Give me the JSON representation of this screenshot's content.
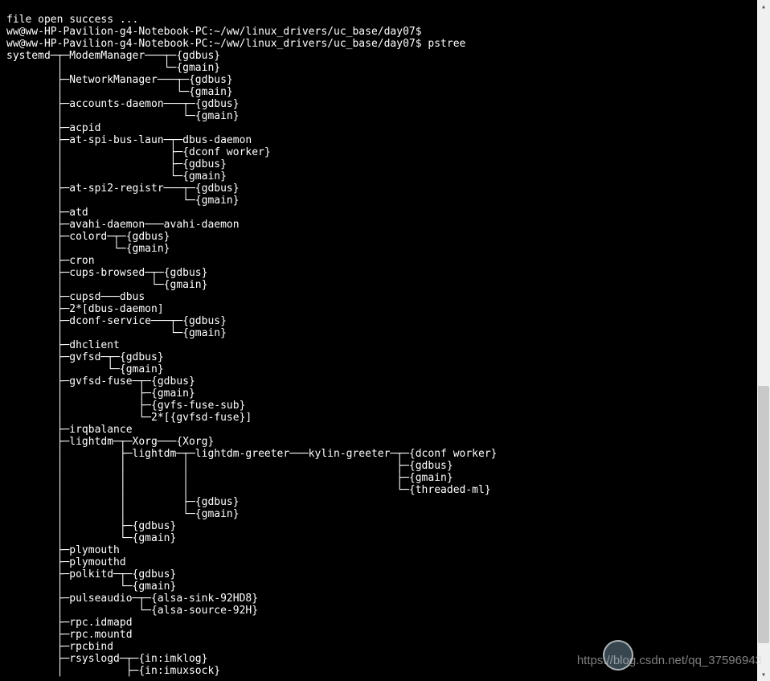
{
  "lines": [
    "file open success ...",
    "ww@ww-HP-Pavilion-g4-Notebook-PC:~/ww/linux_drivers/uc_base/day07$",
    "ww@ww-HP-Pavilion-g4-Notebook-PC:~/ww/linux_drivers/uc_base/day07$ pstree",
    "systemd─┬─ModemManager───┬─{gdbus}",
    "        │                └─{gmain}",
    "        ├─NetworkManager───┬─{gdbus}",
    "        │                  └─{gmain}",
    "        ├─accounts-daemon───┬─{gdbus}",
    "        │                   └─{gmain}",
    "        ├─acpid",
    "        ├─at-spi-bus-laun─┬─dbus-daemon",
    "        │                 ├─{dconf worker}",
    "        │                 ├─{gdbus}",
    "        │                 └─{gmain}",
    "        ├─at-spi2-registr───┬─{gdbus}",
    "        │                   └─{gmain}",
    "        ├─atd",
    "        ├─avahi-daemon───avahi-daemon",
    "        ├─colord─┬─{gdbus}",
    "        │        └─{gmain}",
    "        ├─cron",
    "        ├─cups-browsed─┬─{gdbus}",
    "        │              └─{gmain}",
    "        ├─cupsd───dbus",
    "        ├─2*[dbus-daemon]",
    "        ├─dconf-service───┬─{gdbus}",
    "        │                 └─{gmain}",
    "        ├─dhclient",
    "        ├─gvfsd─┬─{gdbus}",
    "        │       └─{gmain}",
    "        ├─gvfsd-fuse─┬─{gdbus}",
    "        │            ├─{gmain}",
    "        │            ├─{gvfs-fuse-sub}",
    "        │            └─2*[{gvfsd-fuse}]",
    "        ├─irqbalance",
    "        ├─lightdm─┬─Xorg───{Xorg}",
    "        │         ├─lightdm─┬─lightdm-greeter───kylin-greeter─┬─{dconf worker}",
    "        │         │         │                                 ├─{gdbus}",
    "        │         │         │                                 ├─{gmain}",
    "        │         │         │                                 └─{threaded-ml}",
    "        │         │         ├─{gdbus}",
    "        │         │         └─{gmain}",
    "        │         ├─{gdbus}",
    "        │         └─{gmain}",
    "        ├─plymouth",
    "        ├─plymouthd",
    "        ├─polkitd─┬─{gdbus}",
    "        │         └─{gmain}",
    "        ├─pulseaudio─┬─{alsa-sink-92HD8}",
    "        │            └─{alsa-source-92H}",
    "        ├─rpc.idmapd",
    "        ├─rpc.mountd",
    "        ├─rpcbind",
    "        ├─rsyslogd─┬─{in:imklog}",
    "        │          ├─{in:imuxsock}"
  ],
  "watermark_text": "https://blog.csdn.net/qq_37596943",
  "scroll": {
    "up_glyph": "▴",
    "down_glyph": "▾"
  }
}
